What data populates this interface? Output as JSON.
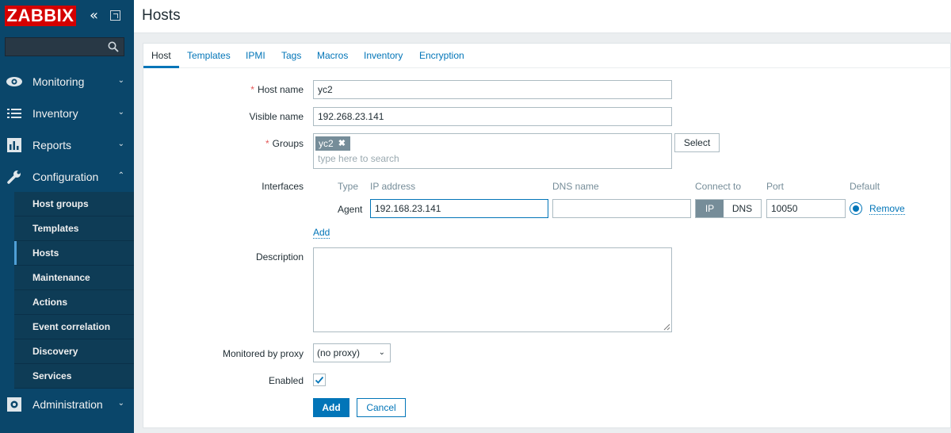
{
  "brand": {
    "logo_text": "ZABBIX",
    "accent": "#d40000",
    "sidebar_bg": "#0a466a",
    "link_color": "#0275b8"
  },
  "search": {
    "value": ""
  },
  "nav": {
    "monitoring": "Monitoring",
    "inventory": "Inventory",
    "reports": "Reports",
    "configuration": "Configuration",
    "administration": "Administration"
  },
  "config_submenu": [
    {
      "label": "Host groups"
    },
    {
      "label": "Templates"
    },
    {
      "label": "Hosts",
      "selected": true
    },
    {
      "label": "Maintenance"
    },
    {
      "label": "Actions"
    },
    {
      "label": "Event correlation"
    },
    {
      "label": "Discovery"
    },
    {
      "label": "Services"
    }
  ],
  "page": {
    "title": "Hosts"
  },
  "tabs": [
    "Host",
    "Templates",
    "IPMI",
    "Tags",
    "Macros",
    "Inventory",
    "Encryption"
  ],
  "form": {
    "host_name_label": "Host name",
    "host_name_value": "yc2",
    "visible_name_label": "Visible name",
    "visible_name_value": "192.268.23.141",
    "groups_label": "Groups",
    "groups_chip": "yc2",
    "groups_placeholder": "type here to search",
    "select_button": "Select",
    "interfaces_label": "Interfaces",
    "interface_headers": {
      "type": "Type",
      "ip": "IP address",
      "dns": "DNS name",
      "connect": "Connect to",
      "port": "Port",
      "default": "Default"
    },
    "interface_row": {
      "type": "Agent",
      "ip": "192.168.23.141",
      "dns": "",
      "connect_ip": "IP",
      "connect_dns": "DNS",
      "port": "10050",
      "remove": "Remove"
    },
    "add_interface_link": "Add",
    "description_label": "Description",
    "description_value": "",
    "proxy_label": "Monitored by proxy",
    "proxy_value": "(no proxy)",
    "enabled_label": "Enabled",
    "enabled": true,
    "add_button": "Add",
    "cancel_button": "Cancel"
  }
}
